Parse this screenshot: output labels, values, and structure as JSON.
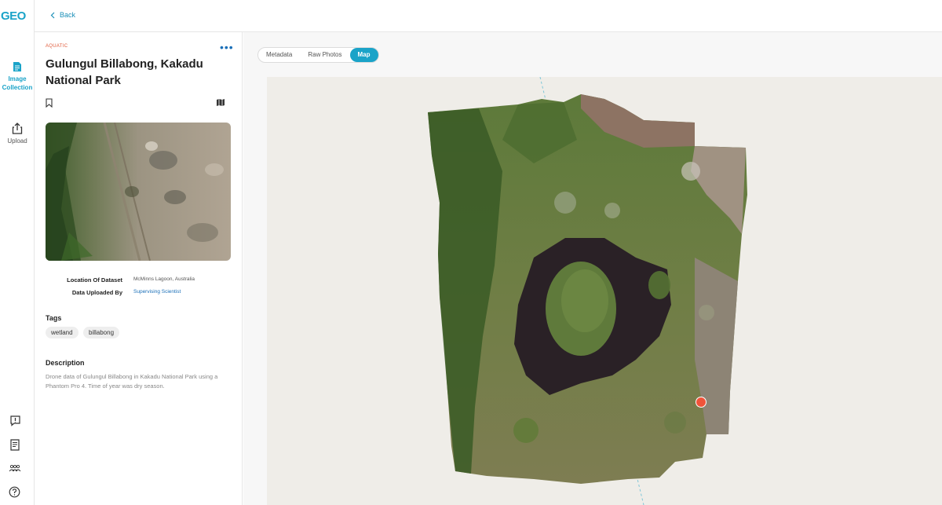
{
  "app": {
    "logo_text": "GEO"
  },
  "topbar": {
    "back_label": "Back"
  },
  "rail": {
    "items": [
      {
        "label": "Image Collection",
        "icon": "document-icon",
        "active": true
      },
      {
        "label": "Upload",
        "icon": "upload-icon",
        "active": false
      }
    ],
    "bottom_icons": [
      "feedback-icon",
      "notes-icon",
      "people-icon",
      "help-icon"
    ]
  },
  "dataset": {
    "category": "AQUATIC",
    "title": "Gulungul Billabong, Kakadu National Park",
    "meta": [
      {
        "key": "Location Of Dataset",
        "value": "McMinns Lagoon, Australia"
      },
      {
        "key": "Data Uploaded By",
        "value": "Supervising Scientist"
      }
    ],
    "tags_heading": "Tags",
    "tags": [
      "wetland",
      "billabong"
    ],
    "description_heading": "Description",
    "description": "Drone data of Gulungul Billabong in Kakadu National Park using a Phantom Pro 4. Time of year was dry season."
  },
  "tabs": [
    {
      "label": "Metadata",
      "active": false
    },
    {
      "label": "Raw Photos",
      "active": false
    },
    {
      "label": "Map",
      "active": true
    }
  ],
  "colors": {
    "accent": "#1aa3c8",
    "category": "#e05a3a",
    "marker": "#f0533a"
  }
}
